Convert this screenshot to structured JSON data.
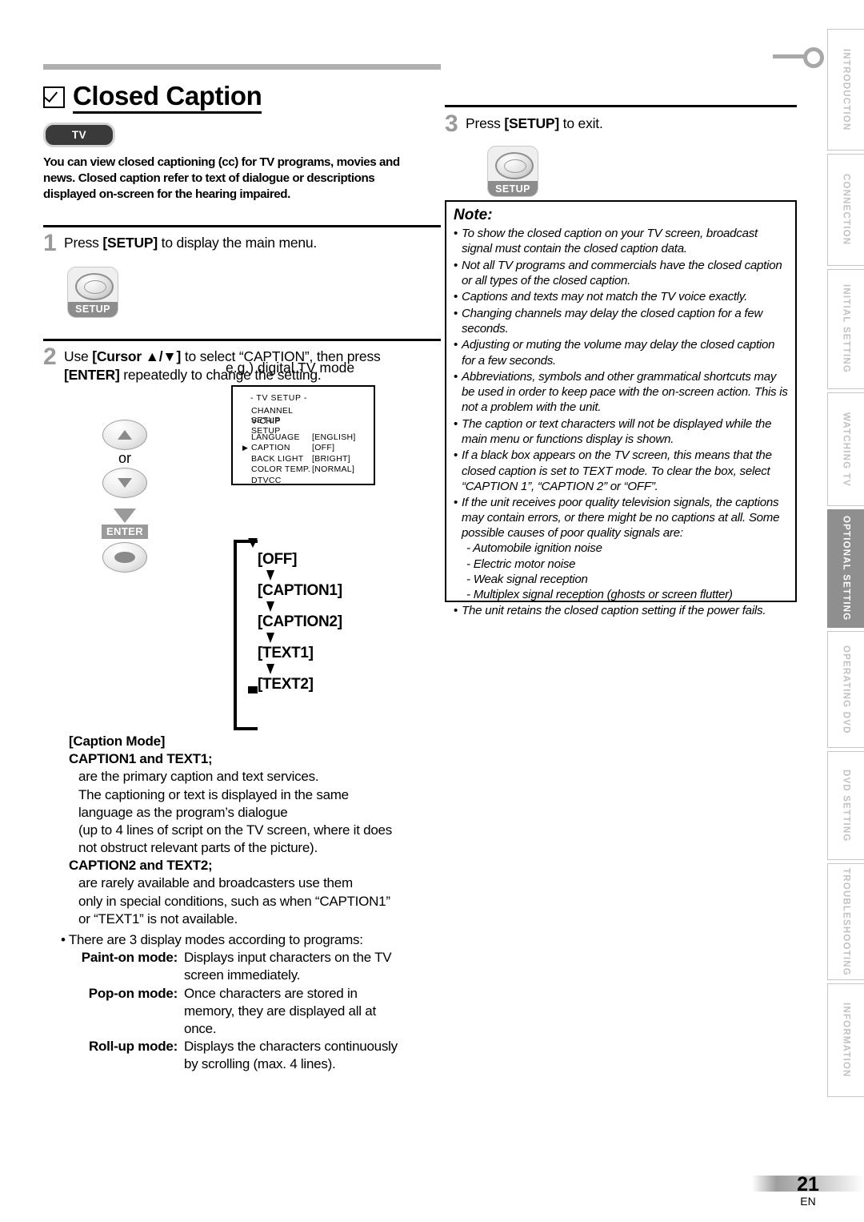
{
  "page": {
    "number": "21",
    "language_code": "EN"
  },
  "header": {
    "checkbox_icon": "checked-box-icon",
    "title": "Closed Caption",
    "device_badge": "TV",
    "intro": "You can view closed captioning (cc) for TV programs, movies and news. Closed caption refer to text of dialogue or descriptions displayed on-screen for the hearing impaired."
  },
  "steps": {
    "step1": {
      "number": "1",
      "text_before": "Press ",
      "key": "[SETUP]",
      "text_after": " to display the main menu.",
      "button_label": "SETUP"
    },
    "step2": {
      "number": "2",
      "line1_a": "Use ",
      "line1_key": "[Cursor ▲/▼]",
      "line1_b": " to select “CAPTION”, then press",
      "line2_key": "[ENTER]",
      "line2_b": " repeatedly to change the setting.",
      "or_label": "or",
      "enter_label": "ENTER",
      "example_label": "e.g.) digital TV mode"
    },
    "step3": {
      "number": "3",
      "text_before": "Press ",
      "key": "[SETUP]",
      "text_after": " to exit.",
      "button_label": "SETUP"
    }
  },
  "menu_screen": {
    "title": "-  TV SETUP  -",
    "rows": [
      {
        "cursor": "",
        "label": "CHANNEL SETUP",
        "value": ""
      },
      {
        "cursor": "",
        "label": "V-CHIP  SETUP",
        "value": ""
      },
      {
        "cursor": "",
        "label": "LANGUAGE",
        "value": "[ENGLISH]"
      },
      {
        "cursor": "▶",
        "label": "CAPTION",
        "value": "[OFF]"
      },
      {
        "cursor": "",
        "label": "BACK  LIGHT",
        "value": "[BRIGHT]"
      },
      {
        "cursor": "",
        "label": "COLOR  TEMP.",
        "value": "[NORMAL]"
      },
      {
        "cursor": "",
        "label": "DTVCC",
        "value": ""
      }
    ]
  },
  "caption_cycle": [
    "[OFF]",
    "[CAPTION1]",
    "[CAPTION2]",
    "[TEXT1]",
    "[TEXT2]"
  ],
  "caption_mode": {
    "heading": "[Caption Mode]",
    "group1_title": "CAPTION1 and TEXT1;",
    "group1_lines": [
      "are the primary caption and text services.",
      "The captioning or text is displayed in the same",
      "language as the program’s dialogue",
      "(up to 4 lines of script on the TV screen, where it does",
      "not obstruct relevant parts of the picture)."
    ],
    "group2_title": "CAPTION2 and TEXT2;",
    "group2_lines": [
      "are rarely available and broadcasters use them",
      "only in special conditions, such as when “CAPTION1”",
      "or “TEXT1” is not available."
    ]
  },
  "display_modes": {
    "intro": "• There are 3 display modes according to programs:",
    "rows": [
      {
        "name": "Paint-on mode:",
        "desc": "Displays input characters on the TV",
        "cont": [
          "screen immediately."
        ]
      },
      {
        "name": "Pop-on mode:",
        "desc": "Once characters are stored in",
        "cont": [
          "memory, they are displayed all at",
          "once."
        ]
      },
      {
        "name": "Roll-up mode:",
        "desc": "Displays the characters continuously",
        "cont": [
          "by scrolling (max. 4 lines)."
        ]
      }
    ]
  },
  "note": {
    "title": "Note:",
    "items": [
      "To show the closed caption on your TV screen, broadcast signal must contain the closed caption data.",
      "Not all TV programs and commercials have the closed caption or all types of the closed caption.",
      "Captions and texts may not match the TV voice exactly.",
      "Changing channels may delay the closed caption for a few seconds.",
      "Adjusting or muting the volume may delay the closed caption for a few seconds.",
      "Abbreviations, symbols and other grammatical shortcuts may be used in order to keep pace with the on-screen action. This is not a problem with the unit.",
      "The caption or text characters will not be displayed while the main menu or functions display is shown.",
      "If a black box appears on the TV screen, this means that the closed caption is set to TEXT mode. To clear the box, select “CAPTION 1”, “CAPTION 2” or “OFF”.",
      "If the unit receives poor quality television signals, the captions may contain errors, or there might be no captions at all. Some possible causes of poor quality signals are:"
    ],
    "sub_items": [
      "- Automobile ignition noise",
      "- Electric motor noise",
      "- Weak signal reception",
      "- Multiplex signal reception (ghosts or screen flutter)"
    ],
    "last_item": "The unit retains the closed caption setting if the power fails."
  },
  "tabs": [
    {
      "label": "INTRODUCTION",
      "active": false
    },
    {
      "label": "CONNECTION",
      "active": false
    },
    {
      "label": "INITIAL  SETTING",
      "active": false
    },
    {
      "label": "WATCHING  TV",
      "active": false
    },
    {
      "label": "OPTIONAL  SETTING",
      "active": true
    },
    {
      "label": "OPERATING  DVD",
      "active": false
    },
    {
      "label": "DVD  SETTING",
      "active": false
    },
    {
      "label": "TROUBLESHOOTING",
      "active": false
    },
    {
      "label": "INFORMATION",
      "active": false
    }
  ],
  "colors": {
    "active_tab": "#8f8f8f",
    "inactive_tab_text": "#c2c2c2",
    "step_number": "#9a9a9a",
    "rule": "#b0b0b0"
  }
}
